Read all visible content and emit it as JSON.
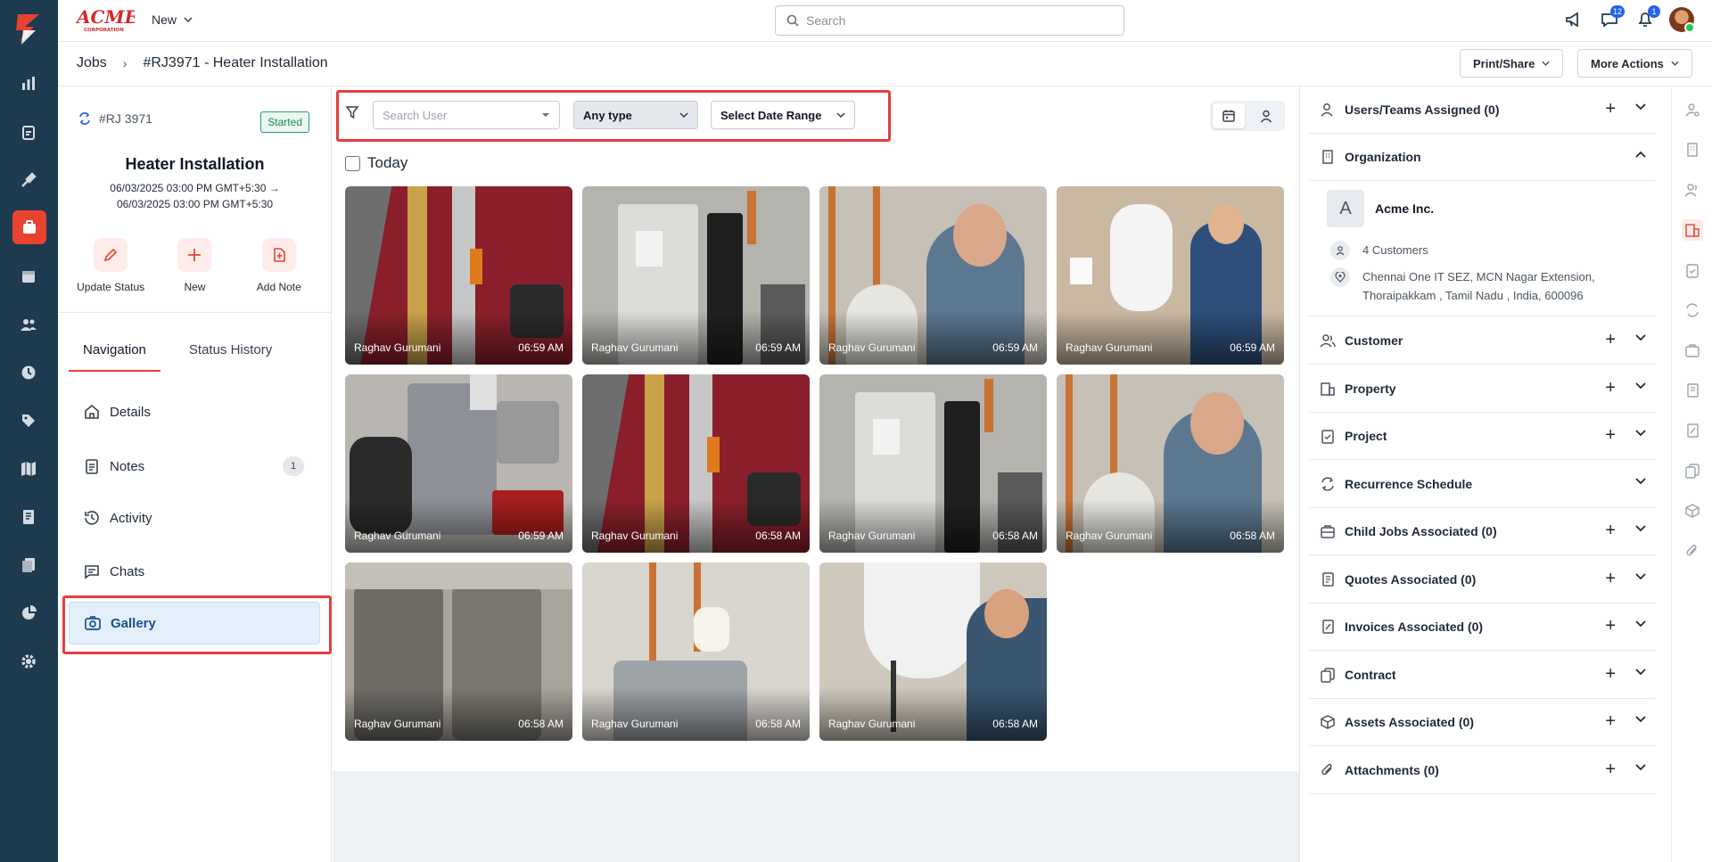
{
  "topbar": {
    "brand": "ACME CORPORATION",
    "new_label": "New",
    "search_placeholder": "Search",
    "chat_badge": "12",
    "notif_badge": "1"
  },
  "breadcrumb": {
    "root": "Jobs",
    "current": "#RJ3971 - Heater Installation",
    "print_share": "Print/Share",
    "more_actions": "More Actions"
  },
  "job": {
    "id": "#RJ 3971",
    "status": "Started",
    "title": "Heater Installation",
    "date_line1": "06/03/2025 03:00 PM GMT+5:30 →",
    "date_line2": "06/03/2025 03:00 PM GMT+5:30",
    "actions": [
      "Update Status",
      "New",
      "Add Note"
    ]
  },
  "left_tabs": [
    "Navigation",
    "Status History"
  ],
  "nav": [
    {
      "label": "Details"
    },
    {
      "label": "Notes",
      "count": "1"
    },
    {
      "label": "Activity"
    },
    {
      "label": "Chats"
    },
    {
      "label": "Gallery"
    }
  ],
  "filters": {
    "user_placeholder": "Search User",
    "type": "Any type",
    "date_range": "Select Date Range"
  },
  "gallery": {
    "group_label": "Today",
    "photos": [
      {
        "user": "Raghav Gurumani",
        "time": "06:59 AM"
      },
      {
        "user": "Raghav Gurumani",
        "time": "06:59 AM"
      },
      {
        "user": "Raghav Gurumani",
        "time": "06:59 AM"
      },
      {
        "user": "Raghav Gurumani",
        "time": "06:59 AM"
      },
      {
        "user": "Raghav Gurumani",
        "time": "06:59 AM"
      },
      {
        "user": "Raghav Gurumani",
        "time": "06:58 AM"
      },
      {
        "user": "Raghav Gurumani",
        "time": "06:58 AM"
      },
      {
        "user": "Raghav Gurumani",
        "time": "06:58 AM"
      },
      {
        "user": "Raghav Gurumani",
        "time": "06:58 AM"
      },
      {
        "user": "Raghav Gurumani",
        "time": "06:58 AM"
      },
      {
        "user": "Raghav Gurumani",
        "time": "06:58 AM"
      }
    ]
  },
  "right": {
    "users_teams": "Users/Teams Assigned (0)",
    "organization": "Organization",
    "org_initial": "A",
    "org_name": "Acme Inc.",
    "org_customers": "4 Customers",
    "org_address_1": "Chennai One IT SEZ, MCN Nagar Extension,",
    "org_address_2": "Thoraipakkam , Tamil Nadu , India, 600096",
    "customer": "Customer",
    "property": "Property",
    "project": "Project",
    "recurrence": "Recurrence Schedule",
    "child_jobs": "Child Jobs Associated (0)",
    "quotes": "Quotes Associated (0)",
    "invoices": "Invoices Associated (0)",
    "contract": "Contract",
    "assets": "Assets Associated (0)",
    "attachments": "Attachments (0)"
  },
  "colors": {
    "rail": "#1d3a4e",
    "accent": "#e8432e",
    "highlight": "#e53e3e",
    "started": "#1d8a5a"
  }
}
